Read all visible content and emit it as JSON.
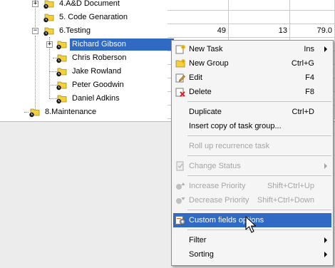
{
  "tree": {
    "rows": [
      {
        "label": "4.A&D Document",
        "values": [
          "",
          "",
          ""
        ]
      },
      {
        "label": "5. Code Genaration",
        "values": [
          "",
          "",
          ""
        ]
      },
      {
        "label": "6.Testing",
        "values": [
          "49",
          "13",
          "79.0"
        ]
      },
      {
        "label": "Richard Gibson",
        "values": [
          "",
          "",
          ""
        ]
      },
      {
        "label": "Chris Roberson",
        "values": [
          "",
          "",
          ""
        ]
      },
      {
        "label": "Jake Rowland",
        "values": [
          "",
          "",
          ""
        ]
      },
      {
        "label": "Peter Goodwin",
        "values": [
          "",
          "",
          ""
        ]
      },
      {
        "label": "Daniel Adkins",
        "values": [
          "",
          "",
          ""
        ]
      },
      {
        "label": "8.Maintenance",
        "values": [
          "",
          "",
          ""
        ]
      }
    ],
    "expander_plus": "+",
    "expander_minus": "−"
  },
  "menu": {
    "items": {
      "new_task": {
        "label": "New Task",
        "shortcut": "Ins"
      },
      "new_group": {
        "label": "New Group",
        "shortcut": "Ctrl+G"
      },
      "edit": {
        "label": "Edit",
        "shortcut": "F4"
      },
      "delete": {
        "label": "Delete",
        "shortcut": "F8"
      },
      "duplicate": {
        "label": "Duplicate",
        "shortcut": "Ctrl+D"
      },
      "insert_copy": {
        "label": "Insert copy of task group..."
      },
      "roll_up": {
        "label": "Roll up recurrence task"
      },
      "change_status": {
        "label": "Change Status"
      },
      "increase_priority": {
        "label": "Increase Priority",
        "shortcut": "Shift+Ctrl+Up"
      },
      "decrease_priority": {
        "label": "Decrease Priority",
        "shortcut": "Shift+Ctrl+Down"
      },
      "custom_fields": {
        "label": "Custom fields options"
      },
      "filter": {
        "label": "Filter"
      },
      "sorting": {
        "label": "Sorting"
      }
    }
  },
  "colors": {
    "selection": "#316ac5",
    "folder": "#f4d03f",
    "disabled_text": "#a5a5a5"
  }
}
